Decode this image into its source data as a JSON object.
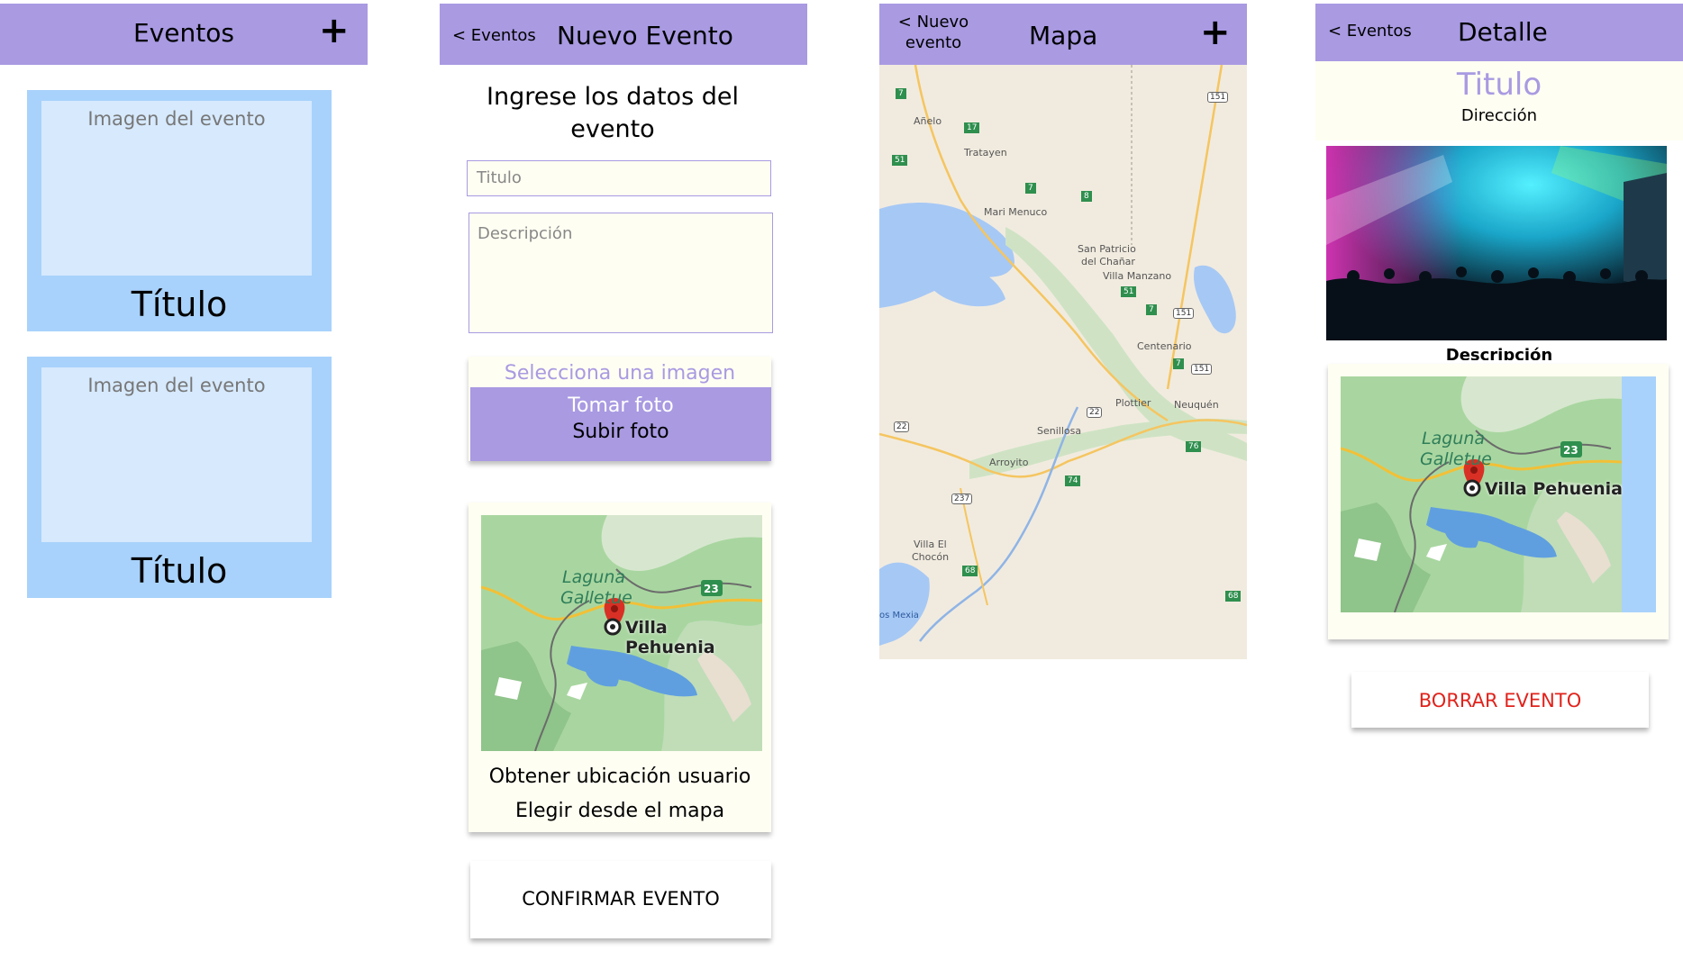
{
  "colors": {
    "header_bg": "#a99ae2",
    "card_bg": "#a8d2fb",
    "card_image": "#d6e9fd",
    "cream": "#fffef2",
    "accent_text": "#a99ae2",
    "danger": "#e0231c"
  },
  "screen1": {
    "header_title": "Eventos",
    "add_icon": "+",
    "cards": [
      {
        "image_placeholder": "Imagen del evento",
        "title": "Título"
      },
      {
        "image_placeholder": "Imagen del evento",
        "title": "Título"
      }
    ]
  },
  "screen2": {
    "back_label": "< Eventos",
    "header_title": "Nuevo Evento",
    "heading_line1": "Ingrese los datos del",
    "heading_line2": "evento",
    "titulo_placeholder": "Titulo",
    "descripcion_placeholder": "Descripción",
    "select_image_label": "Selecciona una imagen",
    "take_photo": "Tomar foto",
    "upload_photo": "Subir foto",
    "map": {
      "lake_label_1": "Laguna",
      "lake_label_2": "Galletue",
      "route": "23",
      "place": "Villa Pehuenia"
    },
    "get_location": "Obtener ubicación usuario",
    "choose_map": "Elegir desde el mapa",
    "confirm": "CONFIRMAR EVENTO"
  },
  "screen3": {
    "back_line1": "< Nuevo",
    "back_line2": "evento",
    "header_title": "Mapa",
    "add_icon": "+",
    "places": [
      "Añelo",
      "Tratayen",
      "Mari Menuco",
      "San Patricio",
      "del Chañar",
      "Villa Manzano",
      "Centenario",
      "Plottier",
      "Neuquén",
      "Senillosa",
      "Arroyito",
      "Villa El",
      "Chocón",
      "os Mexia"
    ],
    "routes": [
      "7",
      "17",
      "51",
      "7",
      "8",
      "151",
      "51",
      "7",
      "151",
      "7",
      "151",
      "22",
      "22",
      "76",
      "74",
      "237",
      "68",
      "68"
    ]
  },
  "screen4": {
    "back_label": "< Eventos",
    "header_title": "Detalle",
    "title": "Titulo",
    "address": "Dirección",
    "description_label": "Descripción",
    "map": {
      "lake_label_1": "Laguna",
      "lake_label_2": "Galletue",
      "route": "23",
      "place": "Villa Pehuenia"
    },
    "delete": "BORRAR EVENTO"
  }
}
